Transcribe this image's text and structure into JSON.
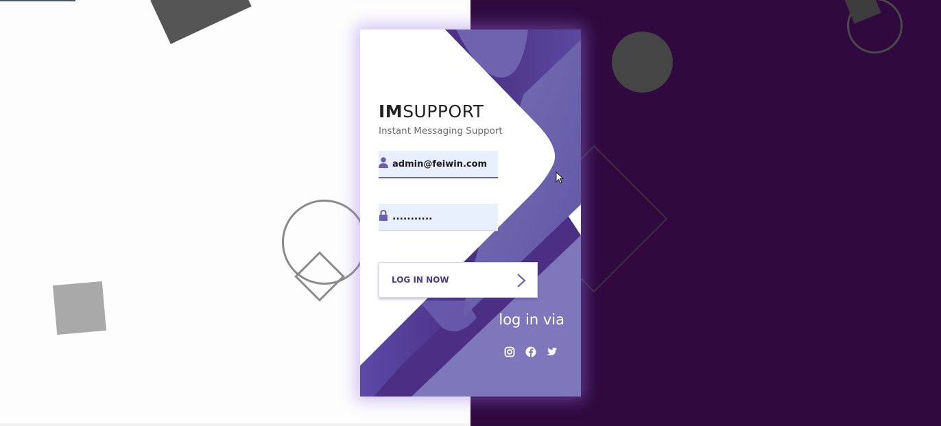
{
  "app": {
    "brand_strong": "IM",
    "brand_light": "SUPPORT",
    "subtitle": "Instant Messaging Support"
  },
  "login_form": {
    "username_value": "admin@feiwin.com",
    "password_value": "...........",
    "submit_label": "LOG IN NOW"
  },
  "social": {
    "heading": "log in via",
    "providers": [
      "instagram-icon",
      "facebook-icon",
      "twitter-icon"
    ]
  },
  "colors": {
    "accent": "#6a5fb0",
    "dark_background": "#30093f",
    "input_background": "#e8f0fe"
  }
}
